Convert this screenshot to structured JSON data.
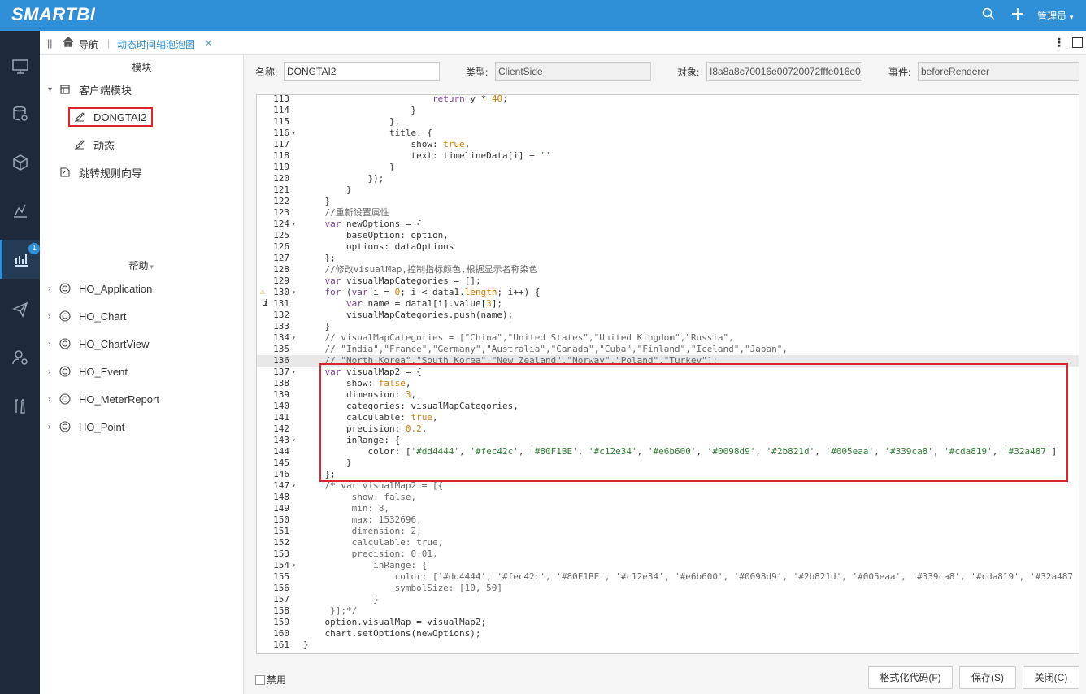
{
  "app": {
    "logo": "SMARTBI"
  },
  "topbar": {
    "user": "管理员"
  },
  "rail": {
    "badge": "1"
  },
  "tabs": {
    "nav_label": "导航",
    "active_tab": "动态时间轴泡泡图",
    "close_glyph": "×"
  },
  "module_panel": {
    "title": "模块",
    "client_module": "客户端模块",
    "items": [
      "DONGTAI2",
      "动态"
    ],
    "redirect_wizard": "跳转规则向导",
    "help_title": "帮助",
    "help_items": [
      "HO_Application",
      "HO_Chart",
      "HO_ChartView",
      "HO_Event",
      "HO_MeterReport",
      "HO_Point"
    ]
  },
  "form": {
    "name_label": "名称:",
    "name_value": "DONGTAI2",
    "type_label": "类型:",
    "type_value": "ClientSide",
    "object_label": "对象:",
    "object_value": "I8a8a8c70016e00720072fffe016e0",
    "event_label": "事件:",
    "event_value": "beforeRenderer"
  },
  "code": {
    "lines": [
      {
        "n": "113",
        "t": "                        return y * 40;"
      },
      {
        "n": "114",
        "t": "                    }"
      },
      {
        "n": "115",
        "t": "                },"
      },
      {
        "n": "116",
        "t": "                title: {"
      },
      {
        "n": "117",
        "t": "                    show: true,"
      },
      {
        "n": "118",
        "t": "                    text: timelineData[i] + ''"
      },
      {
        "n": "119",
        "t": "                }"
      },
      {
        "n": "120",
        "t": "            });"
      },
      {
        "n": "121",
        "t": "        }"
      },
      {
        "n": "122",
        "t": "    }"
      },
      {
        "n": "123",
        "t": "    //重新设置属性"
      },
      {
        "n": "124",
        "t": "    var newOptions = {"
      },
      {
        "n": "125",
        "t": "        baseOption: option,"
      },
      {
        "n": "126",
        "t": "        options: dataOptions"
      },
      {
        "n": "127",
        "t": "    };"
      },
      {
        "n": "128",
        "t": "    //修改visualMap,控制指标颜色,根据显示名称染色"
      },
      {
        "n": "129",
        "t": "    var visualMapCategories = [];"
      },
      {
        "n": "130",
        "t": "    for (var i = 0; i < data1.length; i++) {"
      },
      {
        "n": "131",
        "t": "        var name = data1[i].value[3];"
      },
      {
        "n": "132",
        "t": "        visualMapCategories.push(name);"
      },
      {
        "n": "133",
        "t": "    }"
      },
      {
        "n": "134",
        "t": "    // visualMapCategories = [\"China\",\"United States\",\"United Kingdom\",\"Russia\","
      },
      {
        "n": "135",
        "t": "    // \"India\",\"France\",\"Germany\",\"Australia\",\"Canada\",\"Cuba\",\"Finland\",\"Iceland\",\"Japan\","
      },
      {
        "n": "136",
        "t": "    // \"North Korea\",\"South Korea\",\"New Zealand\",\"Norway\",\"Poland\",\"Turkey\"];"
      },
      {
        "n": "137",
        "t": "    var visualMap2 = {"
      },
      {
        "n": "138",
        "t": "        show: false,"
      },
      {
        "n": "139",
        "t": "        dimension: 3,"
      },
      {
        "n": "140",
        "t": "        categories: visualMapCategories,"
      },
      {
        "n": "141",
        "t": "        calculable: true,"
      },
      {
        "n": "142",
        "t": "        precision: 0.2,"
      },
      {
        "n": "143",
        "t": "        inRange: {"
      },
      {
        "n": "144",
        "t": "            color: ['#dd4444', '#fec42c', '#80F1BE', '#c12e34', '#e6b600', '#0098d9', '#2b821d', '#005eaa', '#339ca8', '#cda819', '#32a487']"
      },
      {
        "n": "145",
        "t": "        }"
      },
      {
        "n": "146",
        "t": "    };"
      },
      {
        "n": "147",
        "t": "    /* var visualMap2 = [{"
      },
      {
        "n": "148",
        "t": "         show: false,"
      },
      {
        "n": "149",
        "t": "         min: 8,"
      },
      {
        "n": "150",
        "t": "         max: 1532696,"
      },
      {
        "n": "151",
        "t": "         dimension: 2,"
      },
      {
        "n": "152",
        "t": "         calculable: true,"
      },
      {
        "n": "153",
        "t": "         precision: 0.01,"
      },
      {
        "n": "154",
        "t": "             inRange: {"
      },
      {
        "n": "155",
        "t": "                 color: ['#dd4444', '#fec42c', '#80F1BE', '#c12e34', '#e6b600', '#0098d9', '#2b821d', '#005eaa', '#339ca8', '#cda819', '#32a487"
      },
      {
        "n": "156",
        "t": "                 symbolSize: [10, 50]"
      },
      {
        "n": "157",
        "t": "             }"
      },
      {
        "n": "158",
        "t": "     }];*/"
      },
      {
        "n": "159",
        "t": "    option.visualMap = visualMap2;"
      },
      {
        "n": "160",
        "t": "    chart.setOptions(newOptions);"
      },
      {
        "n": "161",
        "t": "}"
      }
    ],
    "fold_lines": [
      "116",
      "124",
      "130",
      "134",
      "137",
      "143",
      "147",
      "154"
    ],
    "warning_line": "130",
    "info_line": "131",
    "active_line": "136"
  },
  "footer": {
    "disable_label": "禁用",
    "format_button": "格式化代码(F)",
    "save_button": "保存(S)",
    "close_button": "关闭(C)"
  },
  "colors": {
    "brand": "#2f8fd7",
    "rail": "#1e2a3b",
    "highlight": "#d9262c"
  }
}
